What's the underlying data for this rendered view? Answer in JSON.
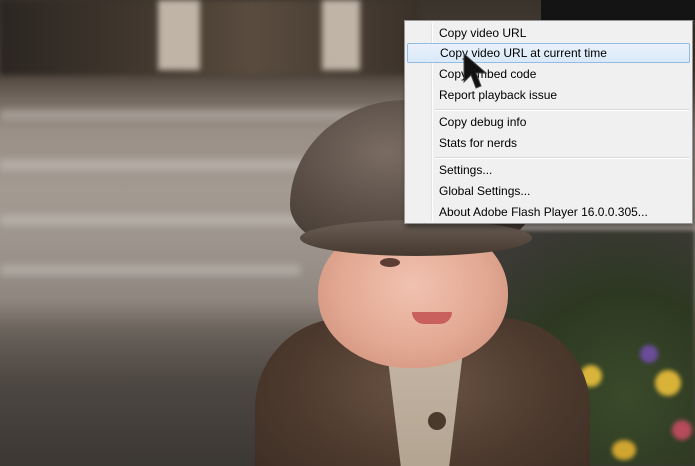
{
  "menu": {
    "items": [
      {
        "label": "Copy video URL",
        "state": "normal"
      },
      {
        "label": "Copy video URL at current time",
        "state": "hover"
      },
      {
        "label": "Copy embed code",
        "state": "normal"
      },
      {
        "label": "Report playback issue",
        "state": "normal"
      },
      {
        "label": "Copy debug info",
        "state": "normal"
      },
      {
        "label": "Stats for nerds",
        "state": "normal"
      },
      {
        "label": "Settings...",
        "state": "normal"
      },
      {
        "label": "Global Settings...",
        "state": "normal"
      },
      {
        "label": "About Adobe Flash Player 16.0.0.305...",
        "state": "normal"
      }
    ]
  },
  "colors": {
    "menu_background": "#f0f0f0",
    "hover_border": "#93bbe3",
    "hover_fill": "#d9e9f8"
  },
  "icons": {
    "cursor": "arrow-cursor-icon"
  }
}
